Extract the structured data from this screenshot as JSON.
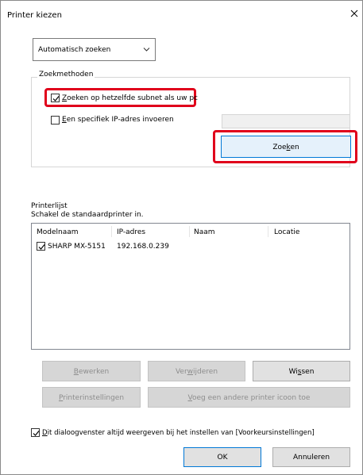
{
  "window": {
    "title": "Printer kiezen"
  },
  "search_mode_select": {
    "value": "Automatisch zoeken"
  },
  "search_methods": {
    "legend": "Zoekmethoden",
    "option_subnet": {
      "label_pre": "",
      "label_accel": "Z",
      "label_post": "oeken op hetzelfde subnet als uw pc",
      "checked": true
    },
    "option_ip": {
      "label_pre": "",
      "label_accel": "E",
      "label_post": "en specifiek IP-adres invoeren",
      "checked": false
    },
    "ip_value": "",
    "search_button": {
      "label_pre": "Zoe",
      "label_accel": "k",
      "label_post": "en"
    }
  },
  "printer_list": {
    "heading": "Printerlijst",
    "subheading": "Schakel de standaardprinter in.",
    "columns": [
      "Modelnaam",
      "IP-adres",
      "Naam",
      "Locatie"
    ],
    "rows": [
      {
        "checked": true,
        "model": "SHARP MX-5151",
        "ip": "192.168.0.239",
        "name": "",
        "location": ""
      }
    ]
  },
  "actions": {
    "edit": {
      "pre": "",
      "accel": "B",
      "post": "ewerken"
    },
    "remove": {
      "pre": "Ver",
      "accel": "w",
      "post": "ijderen"
    },
    "clear": {
      "pre": "Wi",
      "accel": "s",
      "post": "sen"
    },
    "printer_settings": {
      "pre": "",
      "accel": "P",
      "post": "rinterinstellingen"
    },
    "add_icon": {
      "pre": "",
      "accel": "V",
      "post": "oeg een andere printer icoon toe"
    }
  },
  "always_show": {
    "label_pre": "",
    "label_accel": "D",
    "label_post": "it dialoogvenster altijd weergeven bij het instellen van [Voorkeursinstellingen]",
    "checked": true
  },
  "footer": {
    "ok_label": "OK",
    "cancel_label": "Annuleren"
  },
  "colors": {
    "highlight": "#e0001b",
    "focus_blue": "#0078d7"
  }
}
